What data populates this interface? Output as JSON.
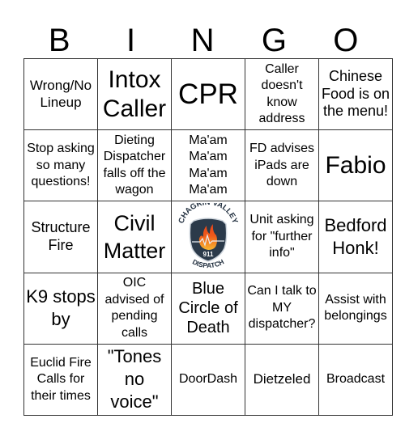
{
  "header": {
    "letters": [
      "B",
      "I",
      "N",
      "G",
      "O"
    ]
  },
  "grid": {
    "rows": [
      [
        "Wrong/No Lineup",
        "Intox Caller",
        "CPR",
        "Caller doesn't know address",
        "Chinese Food is on the menu!"
      ],
      [
        "Stop asking so many questions!",
        "Dieting Dispatcher falls off the wagon",
        "Ma'am Ma'am Ma'am Ma'am",
        "FD advises iPads are down",
        "Fabio"
      ],
      [
        "Structure Fire",
        "Civil Matter",
        "",
        "Unit asking for \"further info\"",
        "Bedford Honk!"
      ],
      [
        "K9 stops by",
        "OIC advised of pending calls",
        "Blue Circle of Death",
        "Can I talk to MY dispatcher?",
        "Assist with belongings"
      ],
      [
        "Euclid Fire Calls for their times",
        "\"Tones no voice\"",
        "DoorDash",
        "Dietzeled",
        "Broadcast"
      ]
    ]
  },
  "free_space": {
    "logo_top_text": "CHAGRIN VALLEY",
    "logo_center_text": "911",
    "logo_bottom_text": "DISPATCH",
    "colors": {
      "shield": "#2b3a4a",
      "flame_outer": "#f05a1a",
      "flame_inner": "#f7b531",
      "text": "#1f2d3d"
    }
  }
}
